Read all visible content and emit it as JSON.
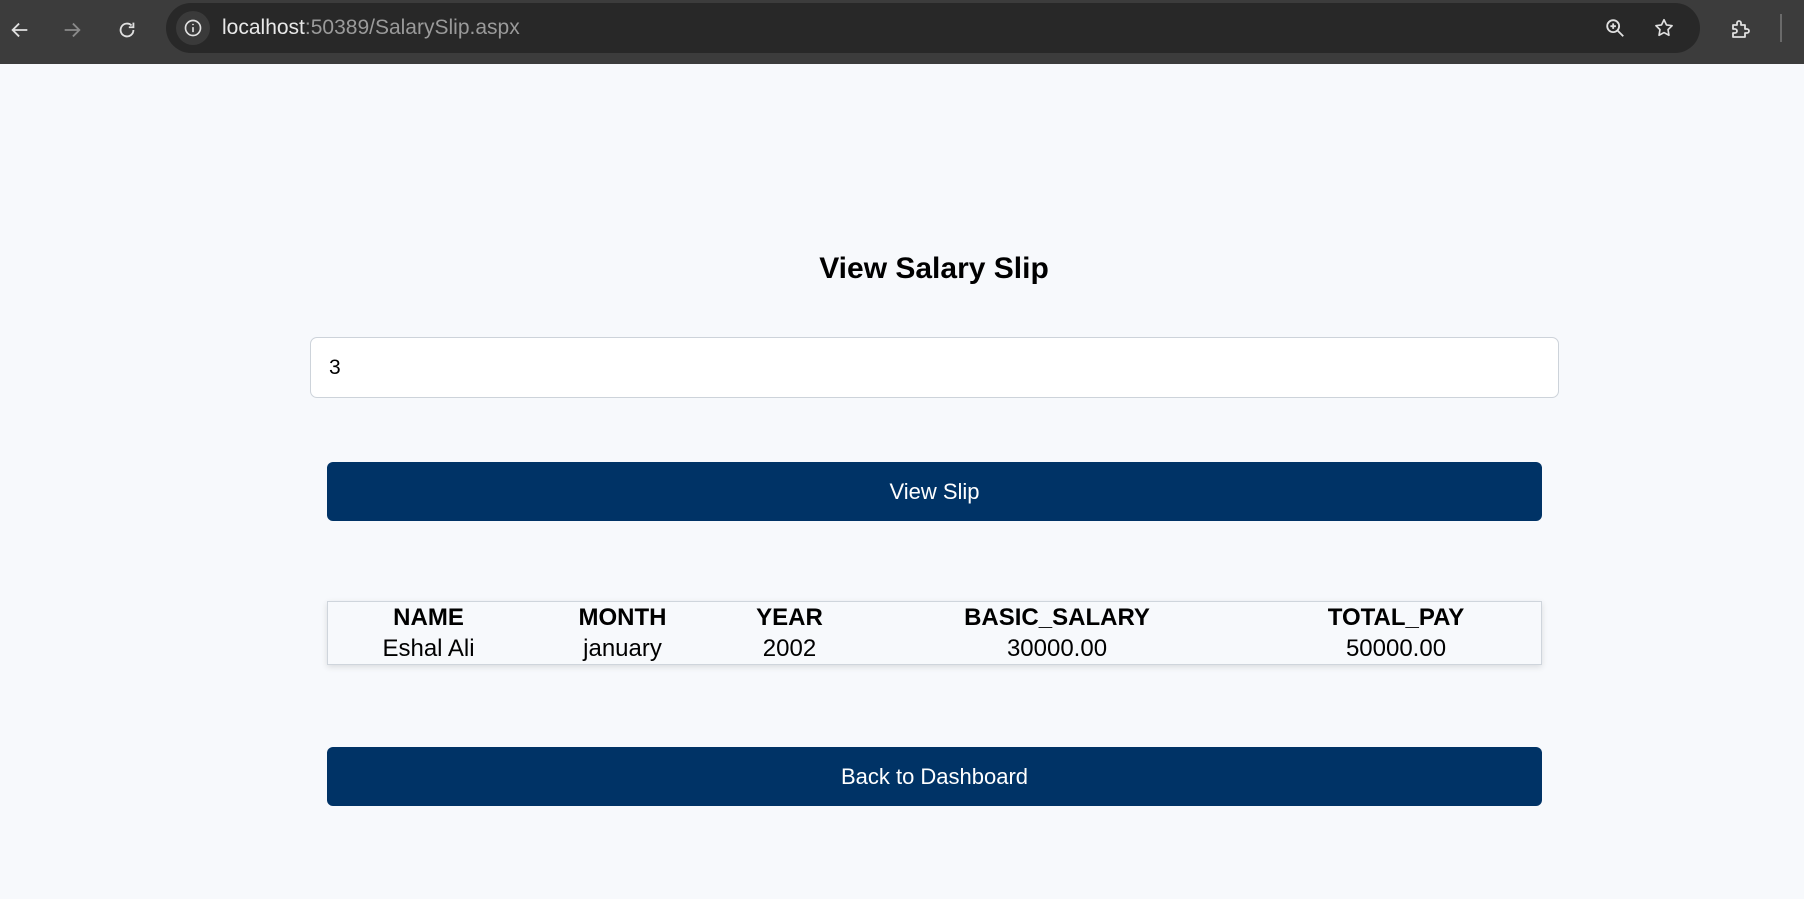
{
  "browser": {
    "url_host": "localhost",
    "url_rest": ":50389/SalarySlip.aspx",
    "icons": [
      "back-arrow-icon",
      "forward-arrow-icon",
      "reload-icon",
      "site-info-icon",
      "zoom-icon",
      "star-icon",
      "extensions-icon"
    ]
  },
  "page": {
    "title": "View Salary Slip",
    "employee_id_value": "3",
    "view_button_label": "View Slip",
    "back_button_label": "Back to Dashboard"
  },
  "table": {
    "headers": [
      "NAME",
      "MONTH",
      "YEAR",
      "BASIC_SALARY",
      "TOTAL_PAY"
    ],
    "rows": [
      [
        "Eshal Ali",
        "january",
        "2002",
        "30000.00",
        "50000.00"
      ]
    ]
  },
  "colors": {
    "button": "#003366",
    "page_background": "#f7f9fc",
    "chrome": "#3c3c3c"
  }
}
